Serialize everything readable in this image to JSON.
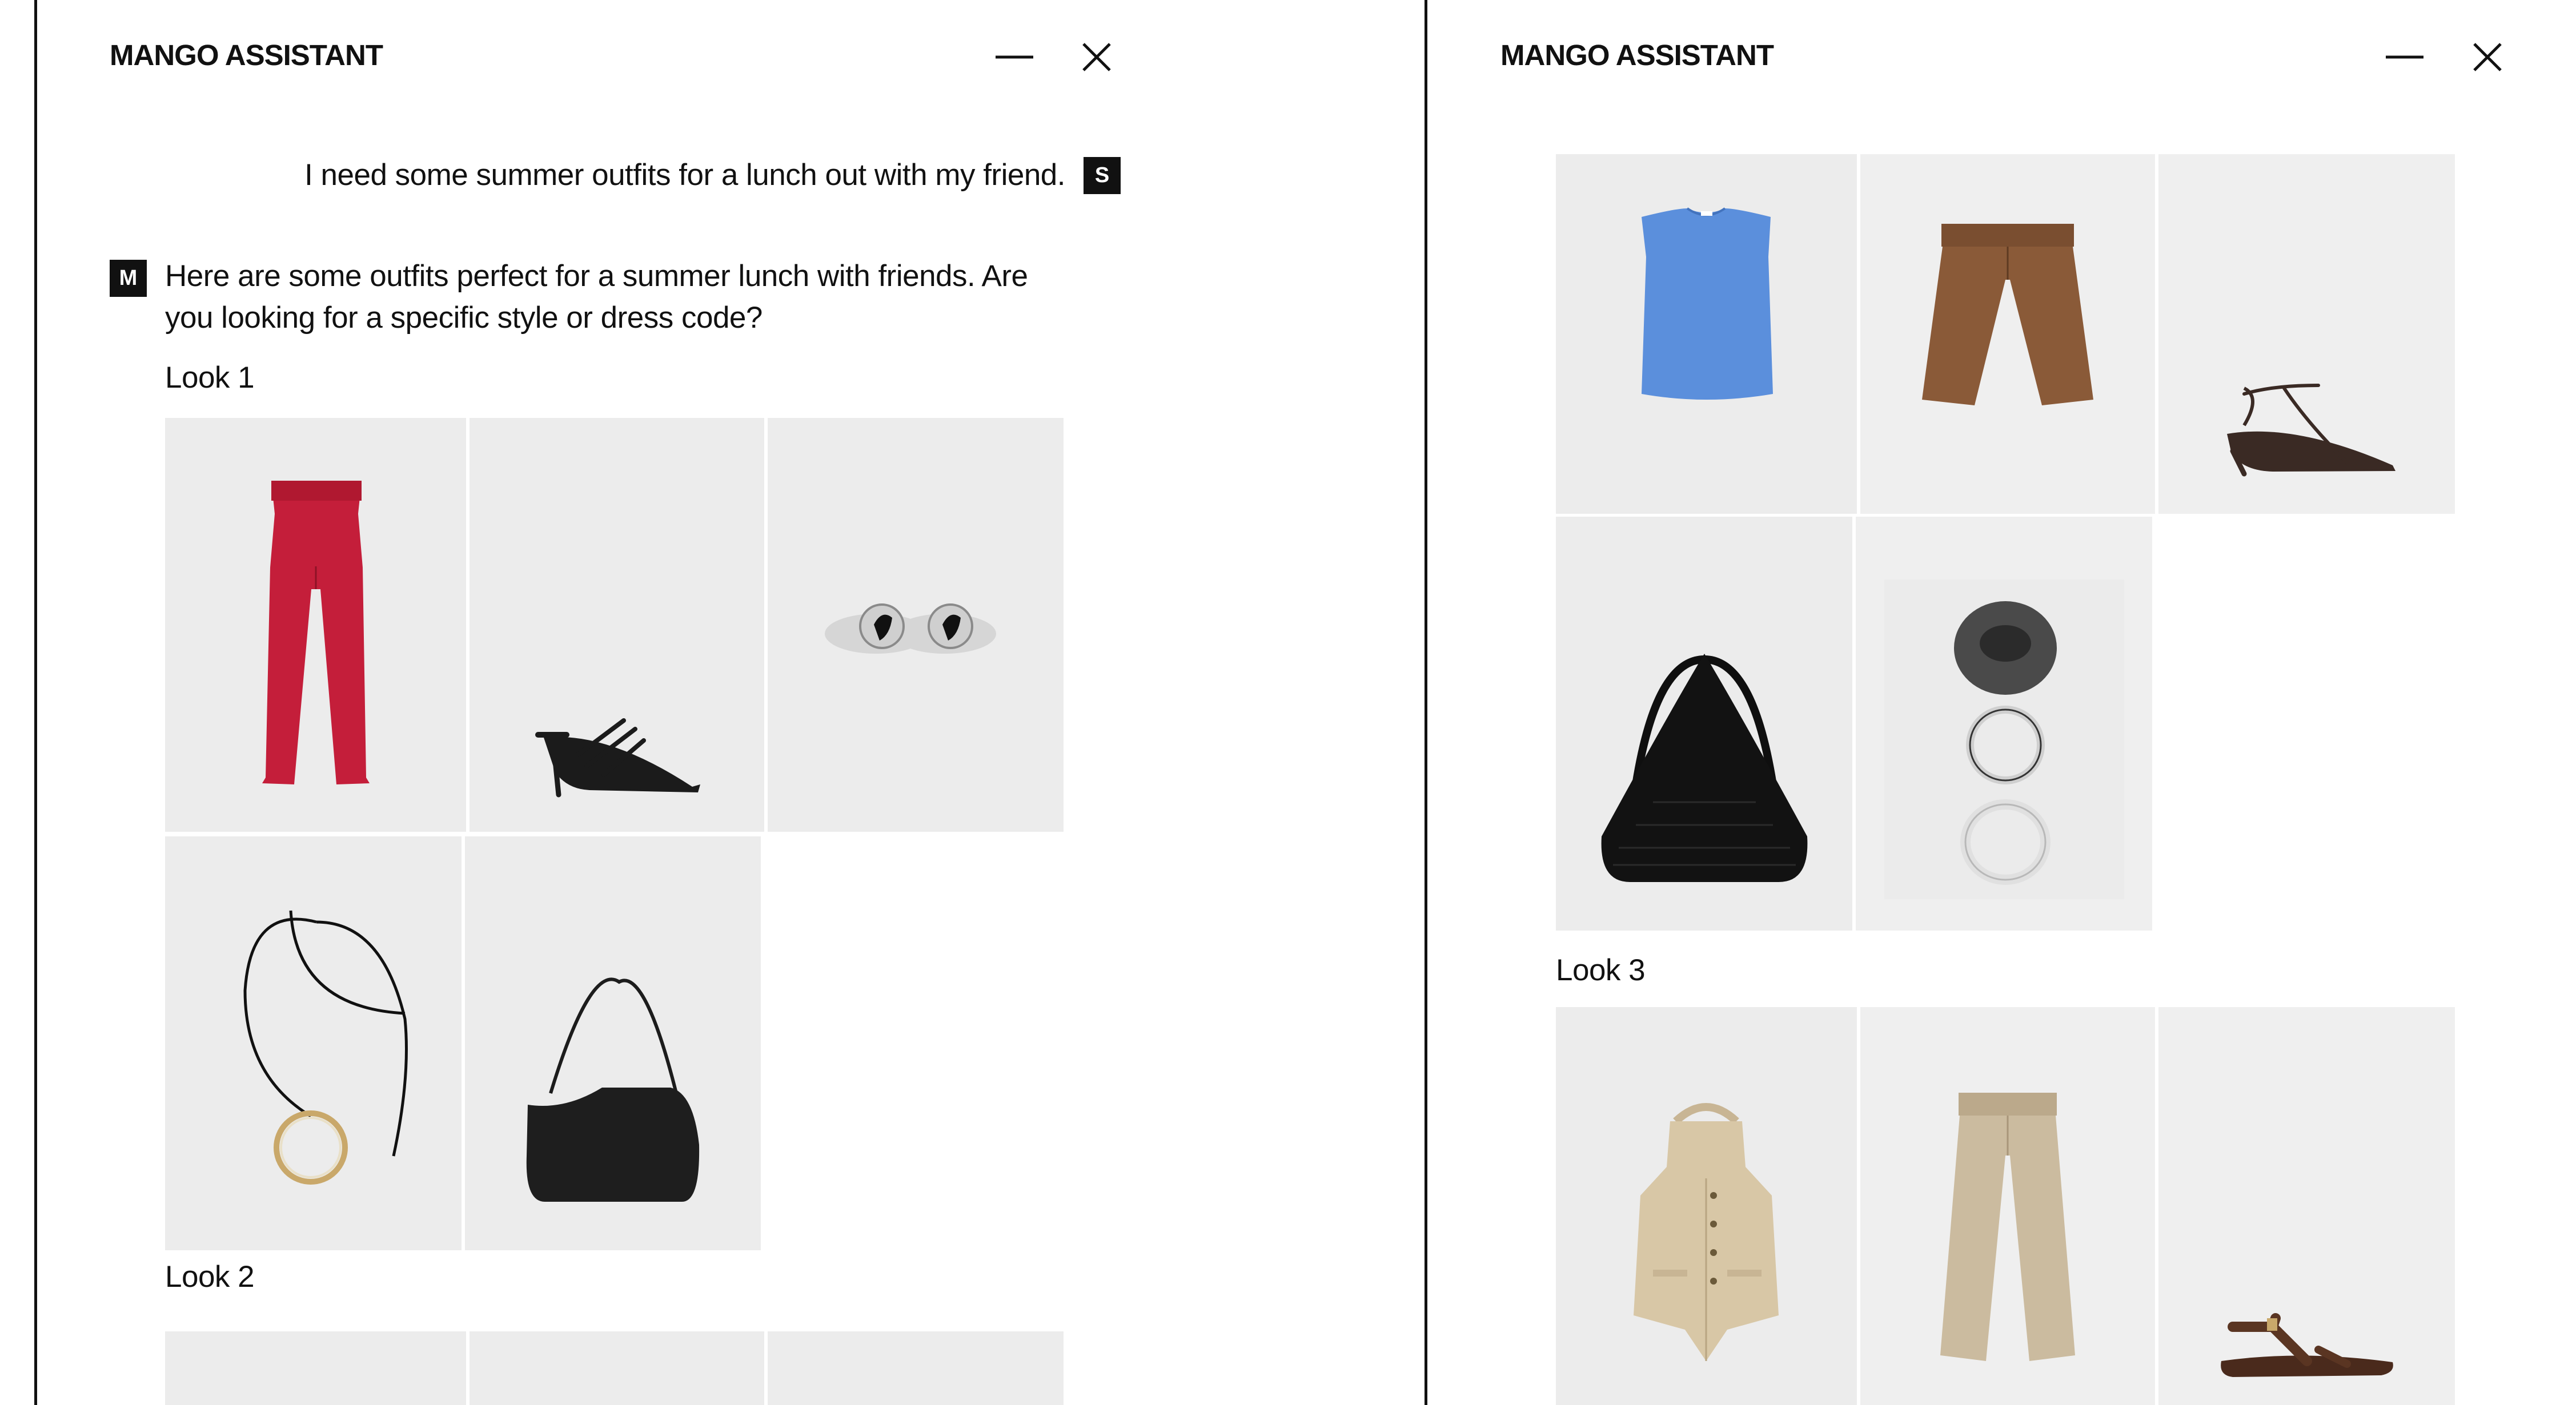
{
  "left_panel": {
    "title": "MANGO ASSISTANT",
    "minimize_label": "Minimize",
    "close_label": "Close",
    "user_message": "I need some summer outfits for a lunch out with my friend.",
    "user_avatar": "S",
    "assistant_avatar": "M",
    "assistant_message": "Here are some outfits perfect for a summer lunch with friends. Are you looking for a specific style or dress code?",
    "looks": [
      {
        "label": "Look 1",
        "items": [
          {
            "name": "red strapless jumpsuit",
            "icon": "jumpsuit-icon"
          },
          {
            "name": "black strappy heeled sandals",
            "icon": "heeled-sandal-icon"
          },
          {
            "name": "silver dome earrings",
            "icon": "earrings-icon"
          },
          {
            "name": "cord necklace with gold ring pendant",
            "icon": "necklace-icon"
          },
          {
            "name": "black shoulder bag",
            "icon": "shoulder-bag-icon"
          }
        ]
      },
      {
        "label": "Look 2"
      }
    ]
  },
  "right_panel": {
    "title": "MANGO ASSISTANT",
    "minimize_label": "Minimize",
    "close_label": "Close",
    "looks": [
      {
        "items": [
          {
            "name": "blue sleeveless top",
            "icon": "top-icon"
          },
          {
            "name": "brown bermuda shorts",
            "icon": "shorts-icon"
          },
          {
            "name": "brown kitten heel sandals",
            "icon": "kitten-heel-icon"
          },
          {
            "name": "black woven hobo bag",
            "icon": "hobo-bag-icon"
          },
          {
            "name": "bangle bracelet set",
            "icon": "bangles-icon"
          }
        ]
      },
      {
        "label": "Look 3",
        "items": [
          {
            "name": "beige halter waistcoat",
            "icon": "waistcoat-icon"
          },
          {
            "name": "beige pleated trousers",
            "icon": "trousers-icon"
          },
          {
            "name": "brown flat sandals",
            "icon": "flat-sandal-icon"
          }
        ]
      }
    ]
  },
  "colors": {
    "text": "#111111",
    "tile_background": "#ececec",
    "avatar_background": "#111111",
    "avatar_text": "#ffffff"
  }
}
